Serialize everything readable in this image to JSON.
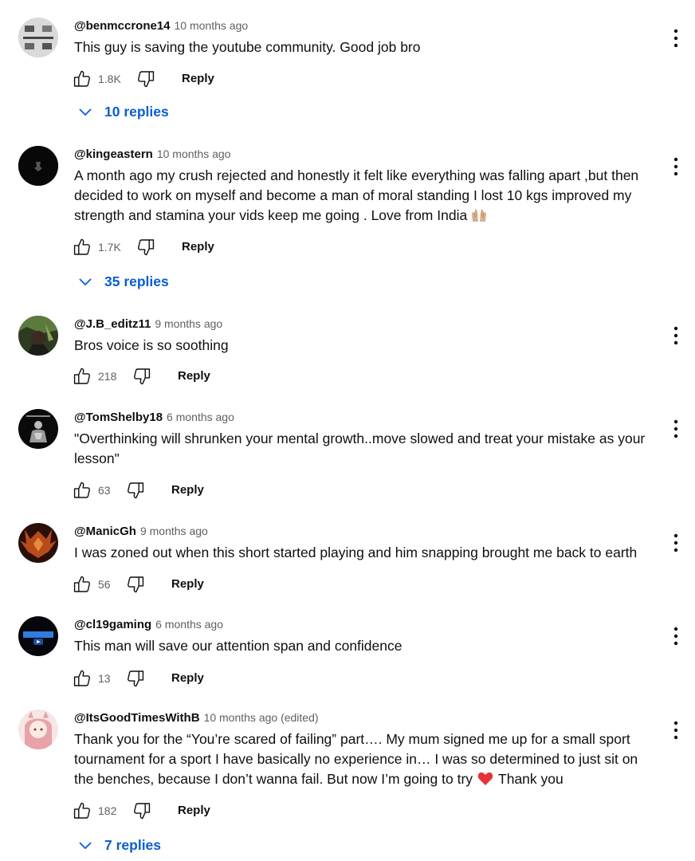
{
  "comments": [
    {
      "author": "@benmccrone14",
      "time": "10 months ago",
      "text": "This guy is saving the youtube community. Good job bro",
      "likes": "1.8K",
      "reply_label": "Reply",
      "replies_label": "10 replies"
    },
    {
      "author": "@kingeastern",
      "time": "10 months ago",
      "text_lines": [
        "A month ago my crush rejected and honestly it felt like everything was falling apart ,but then",
        "decided to work on myself and become a man of moral standing I lost 10 kgs improved my",
        "strength and stamina your vids keep me going . Love from India"
      ],
      "emoji": "raising-hands-emoji",
      "likes": "1.7K",
      "reply_label": "Reply",
      "replies_label": "35 replies"
    },
    {
      "author": "@J.B_editz11",
      "time": "9 months ago",
      "text": "Bros voice is so soothing",
      "likes": "218",
      "reply_label": "Reply"
    },
    {
      "author": "@TomShelby18",
      "time": "6 months ago",
      "text_lines": [
        "\"Overthinking will shrunken your mental growth..move slowed and treat your mistake as your",
        "lesson\""
      ],
      "likes": "63",
      "reply_label": "Reply"
    },
    {
      "author": "@ManicGh",
      "time": "9 months ago",
      "text": "I was zoned out when this short started playing and him snapping brought me back to earth",
      "likes": "56",
      "reply_label": "Reply"
    },
    {
      "author": "@cl19gaming",
      "time": "6 months ago",
      "text": "This man will save our attention span and confidence",
      "likes": "13",
      "reply_label": "Reply"
    },
    {
      "author": "@ItsGoodTimesWithB",
      "time": "10 months ago (edited)",
      "text_lines": [
        "Thank you for the “You’re scared of failing” part…. My mum signed me up for a small sport",
        "tournament for a sport I have basically no experience in… I was so determined to just sit on",
        "the benches, because I don’t wanna fail. But now I’m going to try"
      ],
      "text_tail": "Thank you",
      "emoji": "red-heart-emoji",
      "likes": "182",
      "reply_label": "Reply",
      "replies_label": "7 replies"
    }
  ],
  "colors": {
    "link_blue": "#065fd4",
    "secondary_text": "#606060",
    "primary_text": "#0f0f0f"
  },
  "icons": [
    "thumbs-up-icon",
    "thumbs-down-icon",
    "more-vert-icon",
    "chevron-down-icon"
  ]
}
